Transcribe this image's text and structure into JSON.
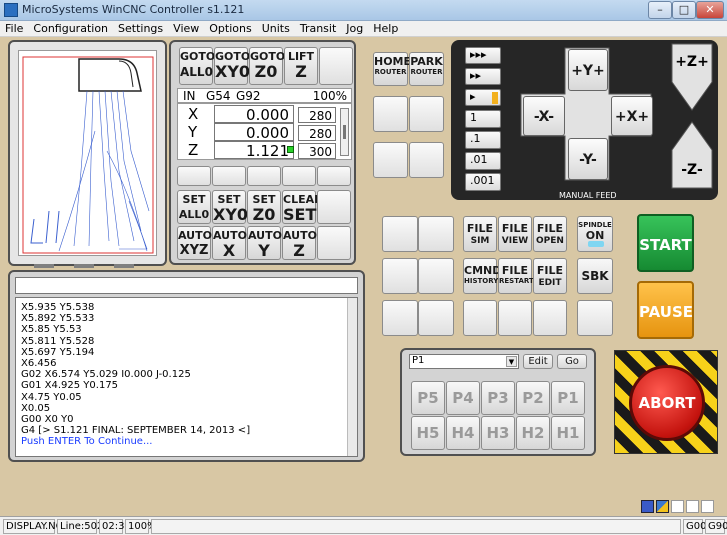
{
  "window": {
    "title": "MicroSystems WinCNC Controller s1.121",
    "min_label": "–",
    "max_label": "□",
    "close_label": "✕"
  },
  "menu": [
    "File",
    "Configuration",
    "Settings",
    "View",
    "Options",
    "Units",
    "Transit",
    "Jog",
    "Help"
  ],
  "top_buttons": [
    {
      "l1": "GOTO",
      "l2": "ALL0"
    },
    {
      "l1": "GOTO",
      "l2": "XY0"
    },
    {
      "l1": "GOTO",
      "l2": "Z0"
    },
    {
      "l1": "LIFT",
      "l2": "Z"
    }
  ],
  "dro": {
    "units": "IN",
    "coord1": "G54",
    "coord2": "G92",
    "percent": "100%",
    "axes": [
      {
        "name": "X",
        "value": "0.000",
        "feed": "280"
      },
      {
        "name": "Y",
        "value": "0.000",
        "feed": "280"
      },
      {
        "name": "Z",
        "value": "1.121",
        "feed": "300"
      }
    ]
  },
  "set_buttons": [
    {
      "l1": "SET",
      "l2": "ALL0"
    },
    {
      "l1": "SET",
      "l2": "XY0"
    },
    {
      "l1": "SET",
      "l2": "Z0"
    },
    {
      "l1": "CLEAR",
      "l2": "SET"
    }
  ],
  "auto_buttons": [
    {
      "l1": "AUTO",
      "l2": "XYZ"
    },
    {
      "l1": "AUTO",
      "l2": "X"
    },
    {
      "l1": "AUTO",
      "l2": "Y"
    },
    {
      "l1": "AUTO",
      "l2": "Z"
    }
  ],
  "gcode": {
    "lines": [
      "X5.935 Y5.538",
      "X5.892 Y5.533",
      "X5.85 Y5.53",
      "X5.811 Y5.528",
      "X5.697 Y5.194",
      "X6.456",
      "G02 X6.574 Y5.029 I0.000 J-0.125",
      "G01 X4.925 Y0.175",
      "X4.75 Y0.05",
      "X0.05",
      "G00 X0 Y0",
      "G4 [> S1.121 FINAL: SEPTEMBER 14, 2013 <]"
    ],
    "prompt": "Push ENTER To Continue..."
  },
  "home_buttons": [
    {
      "l1": "HOME",
      "l2": "ROUTER"
    },
    {
      "l1": "PARK",
      "l2": "ROUTER"
    }
  ],
  "jog": {
    "speeds": [
      "▸▸▸",
      "▸▸",
      "▸",
      "1",
      ".1",
      ".01",
      ".001"
    ],
    "y_plus": "+Y+",
    "y_minus": "-Y-",
    "x_plus": "+X+",
    "x_minus": "-X-",
    "z_plus": "+Z+",
    "z_minus": "-Z-",
    "label": "MANUAL FEED"
  },
  "file_buttons": [
    {
      "l1": "FILE",
      "l2": "SIM"
    },
    {
      "l1": "FILE",
      "l2": "VIEW"
    },
    {
      "l1": "FILE",
      "l2": "OPEN"
    },
    {
      "l1": "CMND",
      "l2": "HISTORY"
    },
    {
      "l1": "FILE",
      "l2": "RESTART"
    },
    {
      "l1": "FILE",
      "l2": "EDIT"
    }
  ],
  "spindle": {
    "l1": "SPINDLE",
    "l2": "ON"
  },
  "sbk_label": "SBK",
  "start_label": "START",
  "pause_label": "PAUSE",
  "abort_label": "ABORT",
  "program": {
    "selected": "P1",
    "edit_label": "Edit",
    "go_label": "Go",
    "grid": [
      "P5",
      "P4",
      "P3",
      "P2",
      "P1",
      "H5",
      "H4",
      "H3",
      "H2",
      "H1"
    ]
  },
  "status": {
    "file": "DISPLAY.NC",
    "line": "Line:5025",
    "time": "02:34",
    "percent": "100%",
    "g00": "G00",
    "g90": "G90"
  },
  "colors": {
    "start": "#1f9d3e",
    "pause": "#f0a318",
    "abort": "#d0201b",
    "prompt_text": "#1a3cff"
  }
}
